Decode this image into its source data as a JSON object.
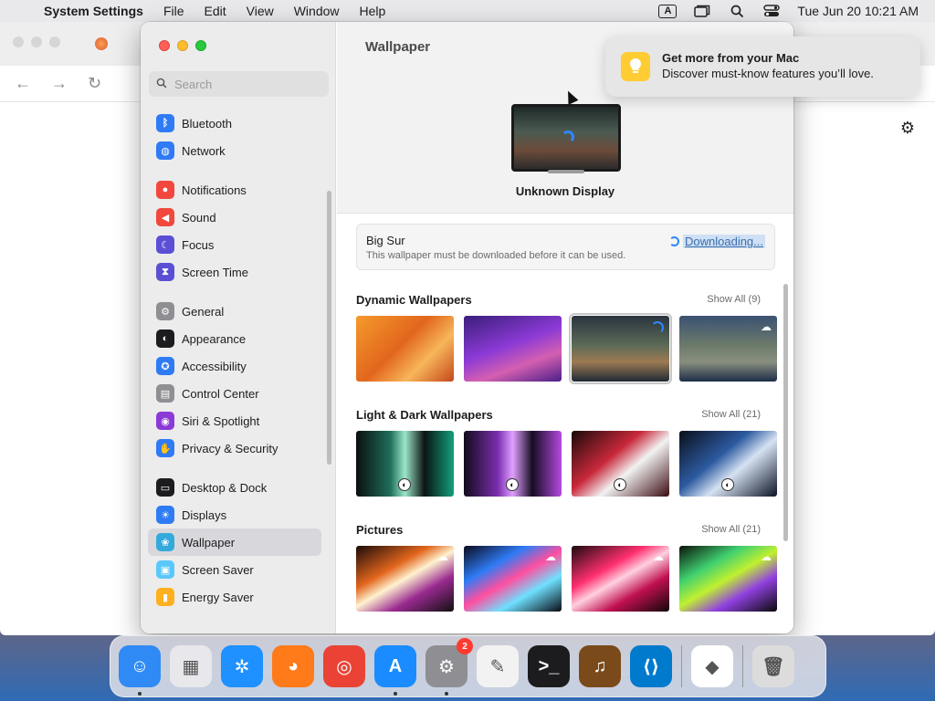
{
  "menubar": {
    "app_name": "System Settings",
    "menus": [
      "File",
      "Edit",
      "View",
      "Window",
      "Help"
    ],
    "input_label": "A",
    "datetime": "Tue Jun 20  10:21 AM"
  },
  "sidebar": {
    "search_placeholder": "Search",
    "items": [
      {
        "label": "Bluetooth",
        "color": "#2f7bf5",
        "icon": "bluetooth-icon",
        "glyph": "ᛒ"
      },
      {
        "label": "Network",
        "color": "#2f7bf5",
        "icon": "globe-icon",
        "glyph": "◍"
      },
      {
        "gap": true
      },
      {
        "label": "Notifications",
        "color": "#f2473d",
        "icon": "bell-icon",
        "glyph": "●"
      },
      {
        "label": "Sound",
        "color": "#f2473d",
        "icon": "speaker-icon",
        "glyph": "◀"
      },
      {
        "label": "Focus",
        "color": "#5b4fd6",
        "icon": "moon-icon",
        "glyph": "☾"
      },
      {
        "label": "Screen Time",
        "color": "#5b4fd6",
        "icon": "hourglass-icon",
        "glyph": "⧗"
      },
      {
        "gap": true
      },
      {
        "label": "General",
        "color": "#8e8e93",
        "icon": "gear-icon",
        "glyph": "⚙"
      },
      {
        "label": "Appearance",
        "color": "#1c1c1e",
        "icon": "appearance-icon",
        "glyph": "◐"
      },
      {
        "label": "Accessibility",
        "color": "#2f7bf5",
        "icon": "accessibility-icon",
        "glyph": "✪"
      },
      {
        "label": "Control Center",
        "color": "#8e8e93",
        "icon": "control-center-icon",
        "glyph": "▤"
      },
      {
        "label": "Siri & Spotlight",
        "color": "#8c3ad6",
        "icon": "siri-icon",
        "glyph": "◉"
      },
      {
        "label": "Privacy & Security",
        "color": "#2f7bf5",
        "icon": "hand-icon",
        "glyph": "✋"
      },
      {
        "gap": true
      },
      {
        "label": "Desktop & Dock",
        "color": "#1c1c1e",
        "icon": "dock-icon",
        "glyph": "▭"
      },
      {
        "label": "Displays",
        "color": "#2f7bf5",
        "icon": "sun-icon",
        "glyph": "☀"
      },
      {
        "label": "Wallpaper",
        "color": "#34aadc",
        "icon": "wallpaper-icon",
        "glyph": "❀",
        "selected": true
      },
      {
        "label": "Screen Saver",
        "color": "#5ac8fa",
        "icon": "screensaver-icon",
        "glyph": "▣"
      },
      {
        "label": "Energy Saver",
        "color": "#ffb020",
        "icon": "battery-icon",
        "glyph": "▮"
      }
    ]
  },
  "main": {
    "title": "Wallpaper",
    "display_name": "Unknown Display",
    "current": {
      "name": "Big Sur",
      "note": "This wallpaper must be downloaded before it can be used.",
      "status": "Downloading..."
    },
    "sections": [
      {
        "title": "Dynamic Wallpapers",
        "show_all": "Show All (9)",
        "thumbs": [
          {
            "bg": "linear-gradient(135deg,#f59a2c,#e2661d 45%,#f7b65a 70%,#c4471a)"
          },
          {
            "bg": "linear-gradient(160deg,#3a1e7a,#8c3ad6 45%,#d45fb0 70%,#4a1f8a)"
          },
          {
            "bg": "linear-gradient(180deg,#2a3440,#5c6b57 45%,#9d7a52 70%,#1f2a35)",
            "current": true,
            "badge": "spin2"
          },
          {
            "bg": "linear-gradient(180deg,#3a5272,#6c7a6b 45%,#8a8f7f 70%,#1e2f48)",
            "badge": "cloud"
          }
        ]
      },
      {
        "title": "Light & Dark Wallpapers",
        "show_all": "Show All (21)",
        "thumbs": [
          {
            "bg": "linear-gradient(90deg,#0b0f0e,#1f6e5a 35%,#9be6c8 50%,#0b1312 70%,#13a07c)",
            "badge": "dark"
          },
          {
            "bg": "linear-gradient(90deg,#130b1a,#7b2fb0 35%,#e0a0ff 50%,#170c22 70%,#b34ae0)",
            "badge": "dark"
          },
          {
            "bg": "linear-gradient(140deg,#1a0a0a,#c8283a 40%,#f2f2f2 60%,#3a0b10)",
            "badge": "dark"
          },
          {
            "bg": "linear-gradient(140deg,#0a0f1a,#2c5aa0 40%,#d6e2f2 60%,#0b1224)",
            "badge": "dark"
          }
        ]
      },
      {
        "title": "Pictures",
        "show_all": "Show All (21)",
        "thumbs": [
          {
            "bg": "linear-gradient(150deg,#1a0a08,#e2661d 35%,#fff2d0 50%,#9a2a90 70%,#101010)",
            "badge": "cloud"
          },
          {
            "bg": "linear-gradient(150deg,#0a0a1a,#2f7bf5 30%,#ff4fa0 50%,#6fe0ff 70%,#0a0a12)",
            "badge": "cloud"
          },
          {
            "bg": "linear-gradient(150deg,#1a0a10,#ff2f6e 35%,#ffd0e0 50%,#c01050 70%,#100608)",
            "badge": "cloud"
          },
          {
            "bg": "linear-gradient(150deg,#0a120a,#40d070 30%,#c0f030 50%,#9040e0 70%,#080a08)",
            "badge": "cloud"
          }
        ]
      }
    ]
  },
  "notification": {
    "title": "Get more from your Mac",
    "body": "Discover must-know features you’ll love."
  },
  "dock": {
    "apps": [
      {
        "name": "finder",
        "color": "#2f8af5",
        "glyph": "☺",
        "running": true
      },
      {
        "name": "launchpad",
        "color": "#e8e8ec",
        "glyph": "▦",
        "running": false
      },
      {
        "name": "safari",
        "color": "#1e90ff",
        "glyph": "✲",
        "running": false
      },
      {
        "name": "firefox",
        "color": "#ff7a18",
        "glyph": "◕",
        "running": false
      },
      {
        "name": "chrome",
        "color": "#ea4335",
        "glyph": "◎",
        "running": false
      },
      {
        "name": "app-store",
        "color": "#1a8cff",
        "glyph": "A",
        "running": true
      },
      {
        "name": "system-settings",
        "color": "#8e8e93",
        "glyph": "⚙",
        "running": true,
        "badge": "2"
      },
      {
        "name": "textedit",
        "color": "#f2f2f2",
        "glyph": "✎",
        "running": false
      },
      {
        "name": "terminal",
        "color": "#1c1c1e",
        "glyph": ">_",
        "running": false
      },
      {
        "name": "garageband",
        "color": "#7a4a1a",
        "glyph": "♫",
        "running": false
      },
      {
        "name": "vscode",
        "color": "#007acc",
        "glyph": "⟨⟩",
        "running": false
      },
      {
        "sep": true
      },
      {
        "name": "visual-studio",
        "color": "#ffffff",
        "glyph": "◆",
        "running": false
      },
      {
        "sep": true
      },
      {
        "name": "trash",
        "color": "#dcdcdc",
        "glyph": "🗑",
        "running": false
      }
    ]
  }
}
